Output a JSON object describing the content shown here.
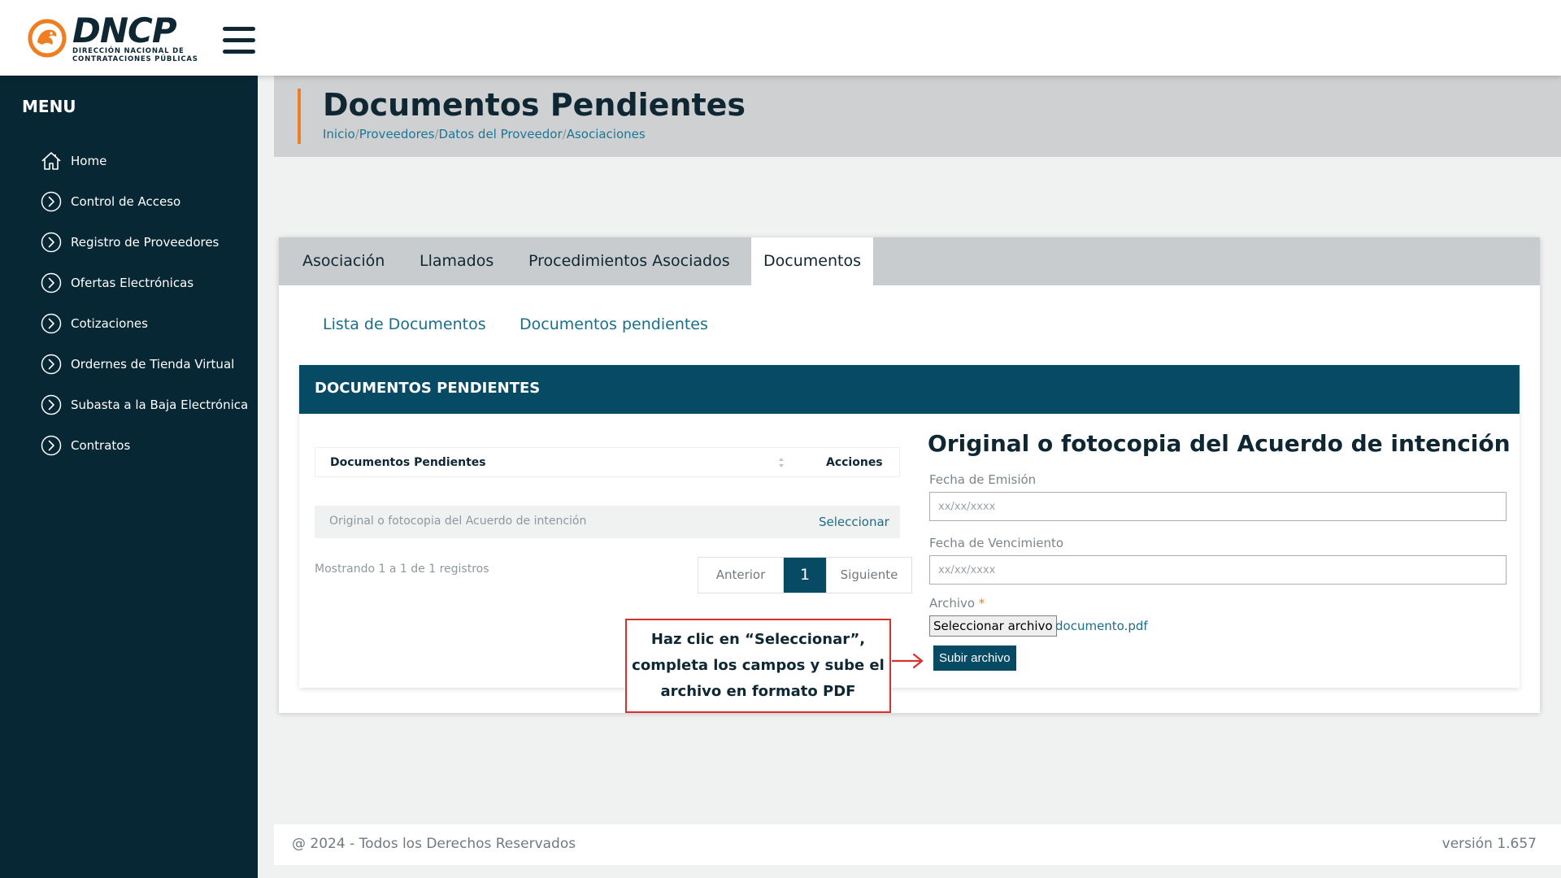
{
  "brand": {
    "name": "DNCP",
    "subtitle_line1": "DIRECCIÓN NACIONAL DE",
    "subtitle_line2": "CONTRATACIONES PÚBLICAS",
    "accent_color": "#ef7d22",
    "dark_color": "#0f2733"
  },
  "sidebar": {
    "title": "MENU",
    "items": [
      {
        "label": "Home",
        "icon": "home-icon"
      },
      {
        "label": "Control de Acceso",
        "icon": "chevron-circle-icon"
      },
      {
        "label": "Registro de Proveedores",
        "icon": "chevron-circle-icon"
      },
      {
        "label": "Ofertas Electrónicas",
        "icon": "chevron-circle-icon"
      },
      {
        "label": "Cotizaciones",
        "icon": "chevron-circle-icon"
      },
      {
        "label": "Ordernes de Tienda Virtual",
        "icon": "chevron-circle-icon"
      },
      {
        "label": "Subasta a la Baja Electrónica",
        "icon": "chevron-circle-icon"
      },
      {
        "label": "Contratos",
        "icon": "chevron-circle-icon"
      }
    ]
  },
  "page": {
    "title": "Documentos Pendientes",
    "breadcrumb": [
      "Inicio",
      "Proveedores",
      "Datos del Proveedor",
      "Asociaciones"
    ],
    "breadcrumb_separator": "/"
  },
  "tabs": [
    {
      "label": "Asociación",
      "active": false
    },
    {
      "label": "Llamados",
      "active": false
    },
    {
      "label": "Procedimientos Asociados",
      "active": false
    },
    {
      "label": "Documentos",
      "active": true
    }
  ],
  "subtabs": [
    {
      "label": "Lista de Documentos"
    },
    {
      "label": "Documentos pendientes"
    }
  ],
  "section": {
    "title": "DOCUMENTOS PENDIENTES",
    "table": {
      "columns": [
        "Documentos Pendientes",
        "Acciones"
      ],
      "rows": [
        {
          "document": "Original o fotocopia del Acuerdo de intención",
          "action": "Seleccionar"
        }
      ]
    },
    "showing": "Mostrando 1 a 1 de 1 registros",
    "pagination": {
      "prev": "Anterior",
      "current": "1",
      "next": "Siguiente"
    }
  },
  "form": {
    "title": "Original o fotocopia del Acuerdo de intención",
    "issue_date_label": "Fecha de Emisión",
    "issue_date_placeholder": "xx/xx/xxxx",
    "expiry_date_label": "Fecha de Vencimiento",
    "expiry_date_placeholder": "xx/xx/xxxx",
    "file_label": "Archivo",
    "file_required_mark": "*",
    "file_button": "Seleccionar archivo",
    "file_name": "documento.pdf",
    "upload_button": "Subir archivo"
  },
  "callout": {
    "text": "Haz clic en “Seleccionar”, completa los campos y sube el archivo en formato PDF",
    "border_color": "#d9302b"
  },
  "footer": {
    "copyright": "@ 2024 - Todos los Derechos Reservados",
    "version": "versión 1.657"
  }
}
